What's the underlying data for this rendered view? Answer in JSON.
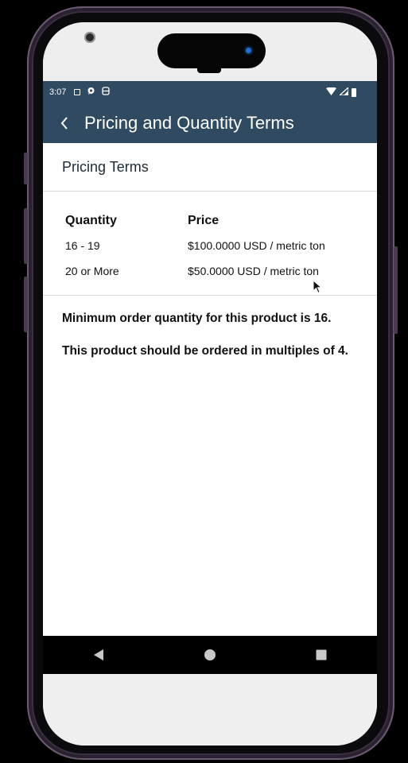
{
  "status_bar": {
    "time": "3:07",
    "left_icons": [
      "a-box-icon",
      "chat-bubble-icon",
      "sim-icon"
    ],
    "right_icons": [
      "wifi-icon",
      "signal-icon",
      "battery-icon"
    ]
  },
  "header": {
    "back_icon": "chevron-left-icon",
    "title": "Pricing and Quantity Terms"
  },
  "section": {
    "title": "Pricing Terms"
  },
  "pricing_table": {
    "headers": {
      "quantity": "Quantity",
      "price": "Price"
    },
    "rows": [
      {
        "quantity": "16 - 19",
        "price": "$100.0000 USD / metric ton"
      },
      {
        "quantity": "20 or More",
        "price": "$50.0000 USD / metric ton"
      }
    ]
  },
  "notes": {
    "minimum_order": "Minimum order quantity for this product is 16.",
    "multiples": "This product should be ordered in multiples of 4."
  },
  "nav": {
    "back": "triangle-back-icon",
    "home": "circle-home-icon",
    "recents": "square-recents-icon"
  },
  "colors": {
    "app_bar": "#2f4a61",
    "phone_frame": "#3b2f3f"
  }
}
